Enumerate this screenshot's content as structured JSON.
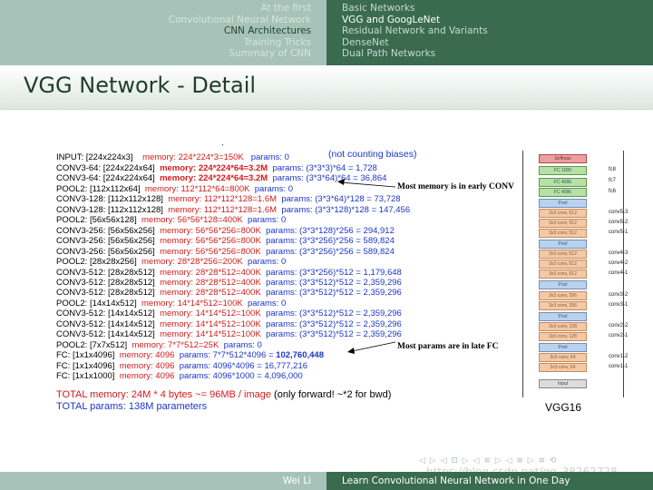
{
  "header": {
    "sections": [
      "At the first",
      "Convolutional Neural Network",
      "CNN Architectures",
      "Training Tricks",
      "Summary of CNN"
    ],
    "subsections": [
      "Basic Networks",
      "VGG and GoogLeNet",
      "Residual Network and Variants",
      "DenseNet",
      "Dual Path Networks"
    ]
  },
  "frame_title": "VGG Network - Detail",
  "figure": {
    "input_line": "INPUT: [224x224x3]",
    "input_mem": "memory:  224*224*3=150K",
    "input_params": "params: 0",
    "not_counting": "(not counting biases)",
    "tick": "`",
    "layers": [
      {
        "layer": "CONV3-64: [224x224x64]",
        "memory": "memory:  224*224*64=3.2M",
        "mem_bold": true,
        "params": "params: (3*3*3)*64 = 1,728",
        "par_bold": false
      },
      {
        "layer": "CONV3-64: [224x224x64]",
        "memory": "memory:  224*224*64=3.2M",
        "mem_bold": true,
        "params": "params: (3*3*64)*64 = 36,864",
        "par_bold": false
      },
      {
        "layer": "POOL2: [112x112x64]",
        "memory": "memory:  112*112*64=800K",
        "mem_bold": false,
        "params": "params: 0",
        "par_bold": false
      },
      {
        "layer": "CONV3-128: [112x112x128]",
        "memory": "memory:  112*112*128=1.6M",
        "mem_bold": false,
        "params": "params: (3*3*64)*128 = 73,728",
        "par_bold": false
      },
      {
        "layer": "CONV3-128: [112x112x128]",
        "memory": "memory:  112*112*128=1.6M",
        "mem_bold": false,
        "params": "params: (3*3*128)*128 = 147,456",
        "par_bold": false
      },
      {
        "layer": "POOL2: [56x56x128]",
        "memory": "memory:  56*56*128=400K",
        "mem_bold": false,
        "params": "params: 0",
        "par_bold": false
      },
      {
        "layer": "CONV3-256: [56x56x256]",
        "memory": "memory:  56*56*256=800K",
        "mem_bold": false,
        "params": "params: (3*3*128)*256 = 294,912",
        "par_bold": false
      },
      {
        "layer": "CONV3-256: [56x56x256]",
        "memory": "memory:  56*56*256=800K",
        "mem_bold": false,
        "params": "params: (3*3*256)*256 = 589,824",
        "par_bold": false
      },
      {
        "layer": "CONV3-256: [56x56x256]",
        "memory": "memory:  56*56*256=800K",
        "mem_bold": false,
        "params": "params: (3*3*256)*256 = 589,824",
        "par_bold": false
      },
      {
        "layer": "POOL2: [28x28x256]",
        "memory": "memory:  28*28*256=200K",
        "mem_bold": false,
        "params": "params: 0",
        "par_bold": false
      },
      {
        "layer": "CONV3-512: [28x28x512]",
        "memory": "memory:  28*28*512=400K",
        "mem_bold": false,
        "params": "params: (3*3*256)*512 = 1,179,648",
        "par_bold": false
      },
      {
        "layer": "CONV3-512: [28x28x512]",
        "memory": "memory:  28*28*512=400K",
        "mem_bold": false,
        "params": "params: (3*3*512)*512 = 2,359,296",
        "par_bold": false
      },
      {
        "layer": "CONV3-512: [28x28x512]",
        "memory": "memory:  28*28*512=400K",
        "mem_bold": false,
        "params": "params: (3*3*512)*512 = 2,359,296",
        "par_bold": false
      },
      {
        "layer": "POOL2: [14x14x512]",
        "memory": "memory:  14*14*512=100K",
        "mem_bold": false,
        "params": "params: 0",
        "par_bold": false
      },
      {
        "layer": "CONV3-512: [14x14x512]",
        "memory": "memory:  14*14*512=100K",
        "mem_bold": false,
        "params": "params: (3*3*512)*512 = 2,359,296",
        "par_bold": false
      },
      {
        "layer": "CONV3-512: [14x14x512]",
        "memory": "memory:  14*14*512=100K",
        "mem_bold": false,
        "params": "params: (3*3*512)*512 = 2,359,296",
        "par_bold": false
      },
      {
        "layer": "CONV3-512: [14x14x512]",
        "memory": "memory:  14*14*512=100K",
        "mem_bold": false,
        "params": "params: (3*3*512)*512 = 2,359,296",
        "par_bold": false
      },
      {
        "layer": "POOL2: [7x7x512]",
        "memory": "memory:  7*7*512=25K",
        "mem_bold": false,
        "params": "params: 0",
        "par_bold": false
      },
      {
        "layer": "FC: [1x1x4096]",
        "memory": "memory:  4096",
        "mem_bold": false,
        "params": "params: 7*7*512*4096 = ",
        "par_bold_tail": "102,760,448"
      },
      {
        "layer": "FC: [1x1x4096]",
        "memory": "memory:  4096",
        "mem_bold": false,
        "params": "params: 4096*4096 = 16,777,216",
        "par_bold": false
      },
      {
        "layer": "FC: [1x1x1000]",
        "memory": "memory:  4096",
        "mem_bold": false,
        "params": "params: 4096*1000 = 4,096,000",
        "par_bold": false
      }
    ],
    "total_memory": "TOTAL memory: 24M * 4 bytes ~= 96MB / image",
    "total_memory_note": " (only forward! ~*2 for bwd)",
    "total_params": "TOTAL params: 138M parameters",
    "note_memory": "Most memory is in early CONV",
    "note_params": "Most params are in late FC",
    "vgg": {
      "caption": "VGG16",
      "boxes": [
        "Softmax",
        "FC 1000",
        "FC 4096",
        "FC 4096",
        "Pool",
        "3x3 conv, 512",
        "3x3 conv, 512",
        "3x3 conv, 512",
        "Pool",
        "3x3 conv, 512",
        "3x3 conv, 512",
        "3x3 conv, 512",
        "Pool",
        "3x3 conv, 256",
        "3x3 conv, 256",
        "Pool",
        "3x3 conv, 128",
        "3x3 conv, 128",
        "Pool",
        "3x3 conv, 64",
        "3x3 conv, 64",
        "Input"
      ],
      "labels": [
        "fc8",
        "fc7",
        "fc6",
        "conv5-3",
        "conv5-2",
        "conv5-1",
        "conv4-3",
        "conv4-2",
        "conv4-1",
        "conv3-2",
        "conv3-1",
        "conv2-2",
        "conv2-1",
        "conv1-2",
        "conv1-1"
      ]
    }
  },
  "footer": {
    "author": "Wei Li",
    "talk_title": "Learn Convolutional Neural Network in One Day"
  },
  "watermark": "https://blog.csdn.net/qq_38262728"
}
